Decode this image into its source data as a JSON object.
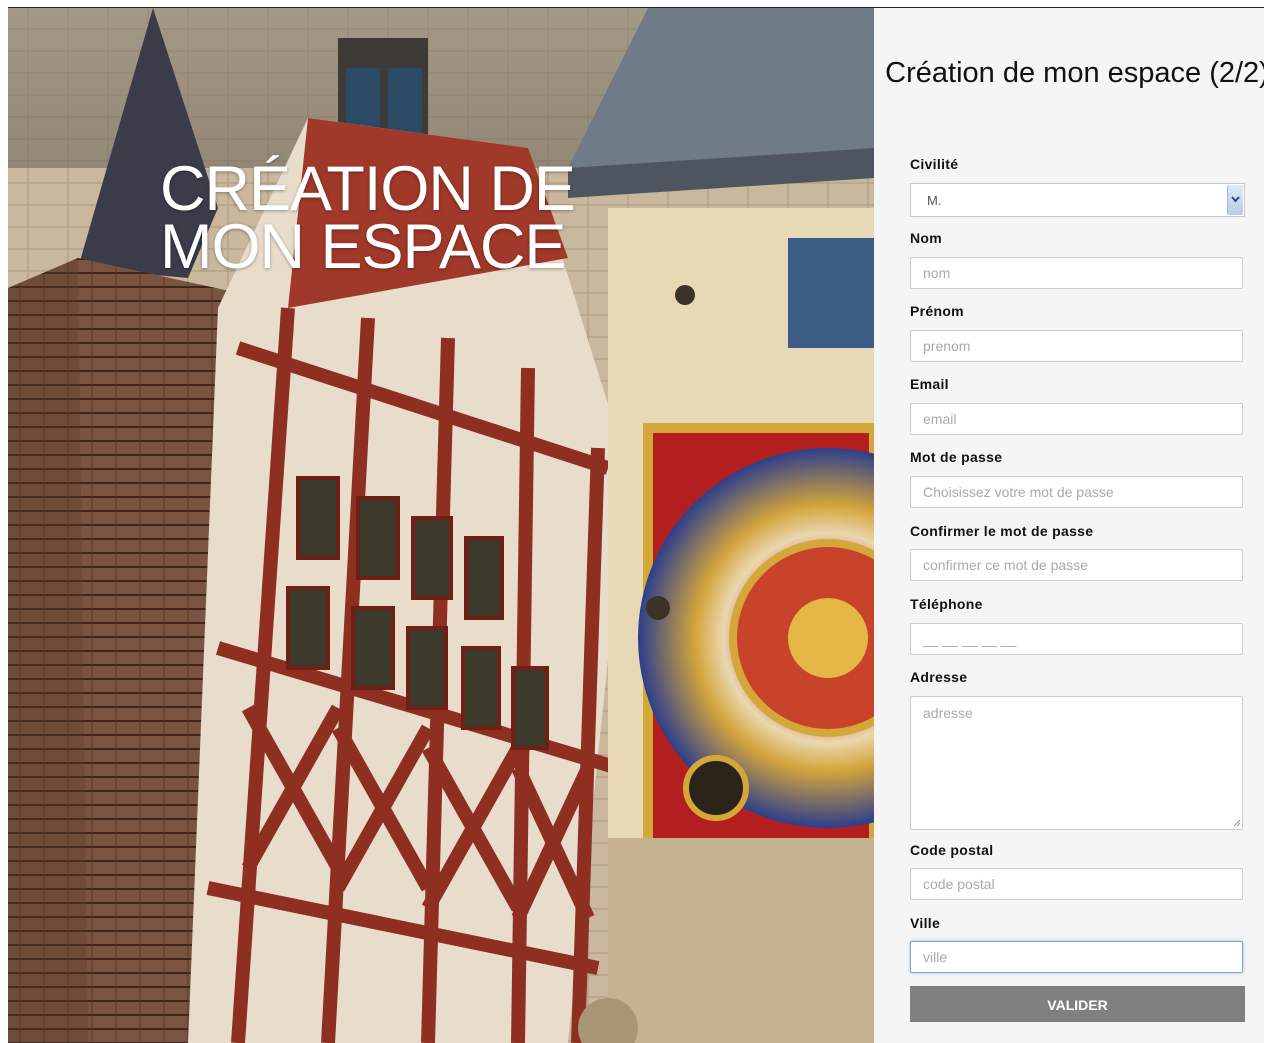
{
  "hero": {
    "title_line1": "CRÉATION DE",
    "title_line2": "MON ESPACE"
  },
  "form": {
    "title": "Création de mon espace (2/2)",
    "civilite": {
      "label": "Civilité",
      "value": "M."
    },
    "nom": {
      "label": "Nom",
      "placeholder": "nom"
    },
    "prenom": {
      "label": "Prénom",
      "placeholder": "prenom"
    },
    "email": {
      "label": "Email",
      "placeholder": "email"
    },
    "password": {
      "label": "Mot de passe",
      "placeholder": "Choisissez votre mot de passe"
    },
    "confirm": {
      "label": "Confirmer le mot de passe",
      "placeholder": "confirmer ce mot de passe"
    },
    "telephone": {
      "label": "Téléphone",
      "placeholder": "__ __ __ __ __"
    },
    "adresse": {
      "label": "Adresse",
      "placeholder": "adresse"
    },
    "code_postal": {
      "label": "Code postal",
      "placeholder": "code postal"
    },
    "ville": {
      "label": "Ville",
      "placeholder": "ville"
    },
    "submit_label": "VALIDER"
  }
}
